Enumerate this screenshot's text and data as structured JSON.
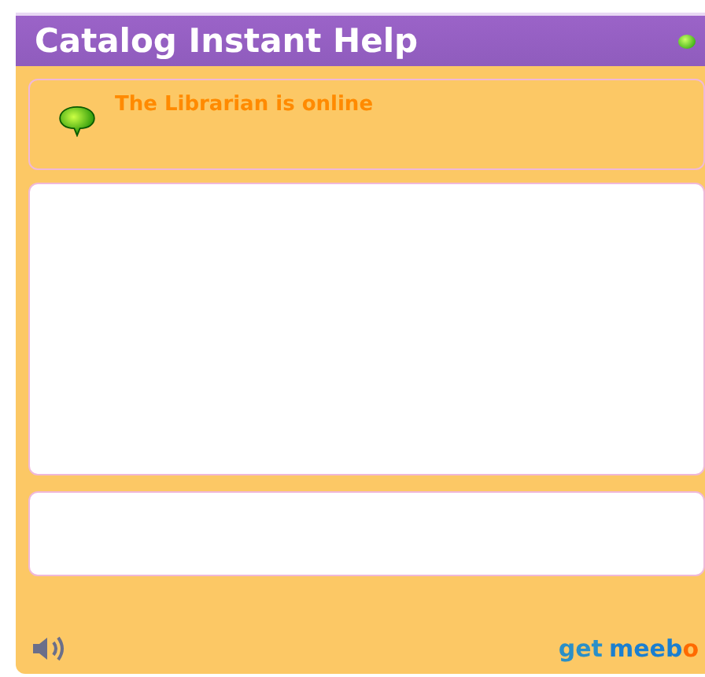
{
  "window": {
    "title": "Catalog Instant Help",
    "online": true
  },
  "status": {
    "message": "The Librarian is online",
    "online": true
  },
  "chat": {
    "kind": "log"
  },
  "input": {
    "kind": "message"
  },
  "footer": {
    "sound_on": true,
    "link_prefix": "get",
    "link_brand": "meebo"
  }
}
